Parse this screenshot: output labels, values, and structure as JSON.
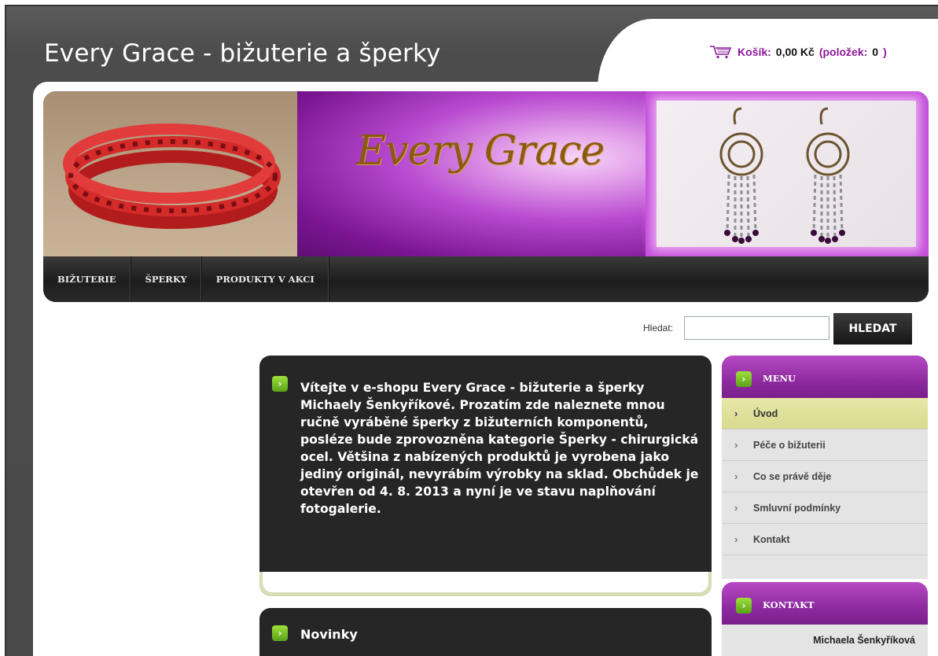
{
  "header": {
    "site_title": "Every Grace - bižuterie a šperky",
    "cart_label": "Košík:",
    "cart_amount": "0,00 Kč",
    "cart_items_open": "(položek:",
    "cart_items_count": "0",
    "cart_items_close": ")"
  },
  "banner": {
    "logo_text": "Every Grace"
  },
  "nav": {
    "items": [
      "BIŽUTERIE",
      "ŠPERKY",
      "PRODUKTY V AKCI"
    ]
  },
  "search": {
    "label": "Hledat:",
    "value": "",
    "button": "HLEDAT"
  },
  "welcome": {
    "text": "Vítejte v   e-shopu Every Grace - bižuterie a šperky Michaely Šenkyříkové. Prozatím zde naleznete mnou ručně vyráběné šperky z bižuterních komponentů, posléze bude zprovozněna  kategorie Šperky - chirurgická ocel.  Většina z nabízených produktů je vyrobena jako jediný originál, nevyrábím výrobky na sklad.   Obchůdek je otevřen od 4. 8. 2013 a  nyní je ve stavu naplňování fotogalerie."
  },
  "news": {
    "title": "Novinky"
  },
  "sidebar": {
    "menu_title": "MENU",
    "menu_items": [
      "Úvod",
      "Péče o bižuterii",
      "Co se právě děje",
      "Smluvní podmínky",
      "Kontakt"
    ],
    "contact_title": "KONTAKT",
    "contact_name": "Michaela Šenkyříková"
  },
  "icons": {
    "cart": "cart-icon",
    "arrow": "arrow-right-icon",
    "chevron": "chevron-right-icon"
  },
  "colors": {
    "accent_purple": "#8e2aa0",
    "cart_text": "#8b1a9a",
    "arrow_green": "#6bb51f",
    "active_menu": "#dfe09a"
  }
}
